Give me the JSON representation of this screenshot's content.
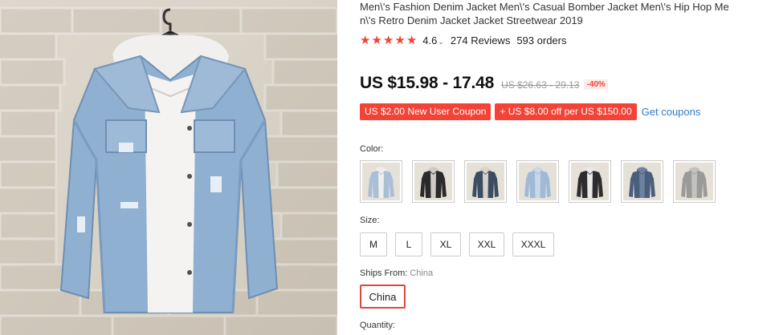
{
  "product": {
    "title": "Men\\'s Fashion Denim Jacket Men\\'s Casual Bomber Jacket Men\\'s Hip Hop Men\\'s Retro Denim Jacket Jacket Streetwear 2019",
    "image_alt": "Light blue distressed denim jacket with white hoodie on hanger"
  },
  "rating": {
    "stars": 5,
    "value": "4.6",
    "reviews": "274 Reviews",
    "orders": "593 orders",
    "star_color": "#f44336"
  },
  "price": {
    "current": "US $15.98 - 17.48",
    "original": "US $26.63 - 29.13",
    "discount": "-40%"
  },
  "coupons": {
    "new_user": "US $2.00 New User Coupon",
    "store": "+ US $8.00 off per US $150.00",
    "get_label": "Get coupons",
    "coupon_color": "#f44336",
    "link_color": "#2e7bcf"
  },
  "color": {
    "label": "Color:",
    "swatches": [
      {
        "name": "light blue with white hood",
        "jacket": "#a9bfd6",
        "hood": "#eeeeee"
      },
      {
        "name": "black with grey hood",
        "jacket": "#2a2a2a",
        "hood": "#cfcac3"
      },
      {
        "name": "dark blue with grey hood",
        "jacket": "#3c4d63",
        "hood": "#d8d2ca"
      },
      {
        "name": "light blue plain",
        "jacket": "#9fb9d6",
        "hood": "#c9d8e8"
      },
      {
        "name": "black with white hood",
        "jacket": "#2d2d2d",
        "hood": "#e9e9e9"
      },
      {
        "name": "dark blue plain",
        "jacket": "#4a5f7d",
        "hood": "#6d82a0"
      },
      {
        "name": "grey distressed",
        "jacket": "#9a9a98",
        "hood": "#c2c2c0"
      }
    ]
  },
  "size": {
    "label": "Size:",
    "options": [
      "M",
      "L",
      "XL",
      "XXL",
      "XXXL"
    ]
  },
  "ships": {
    "label": "Ships From:",
    "value": "China",
    "option": "China",
    "selected_color": "#e0473c"
  },
  "quantity": {
    "label": "Quantity:"
  }
}
